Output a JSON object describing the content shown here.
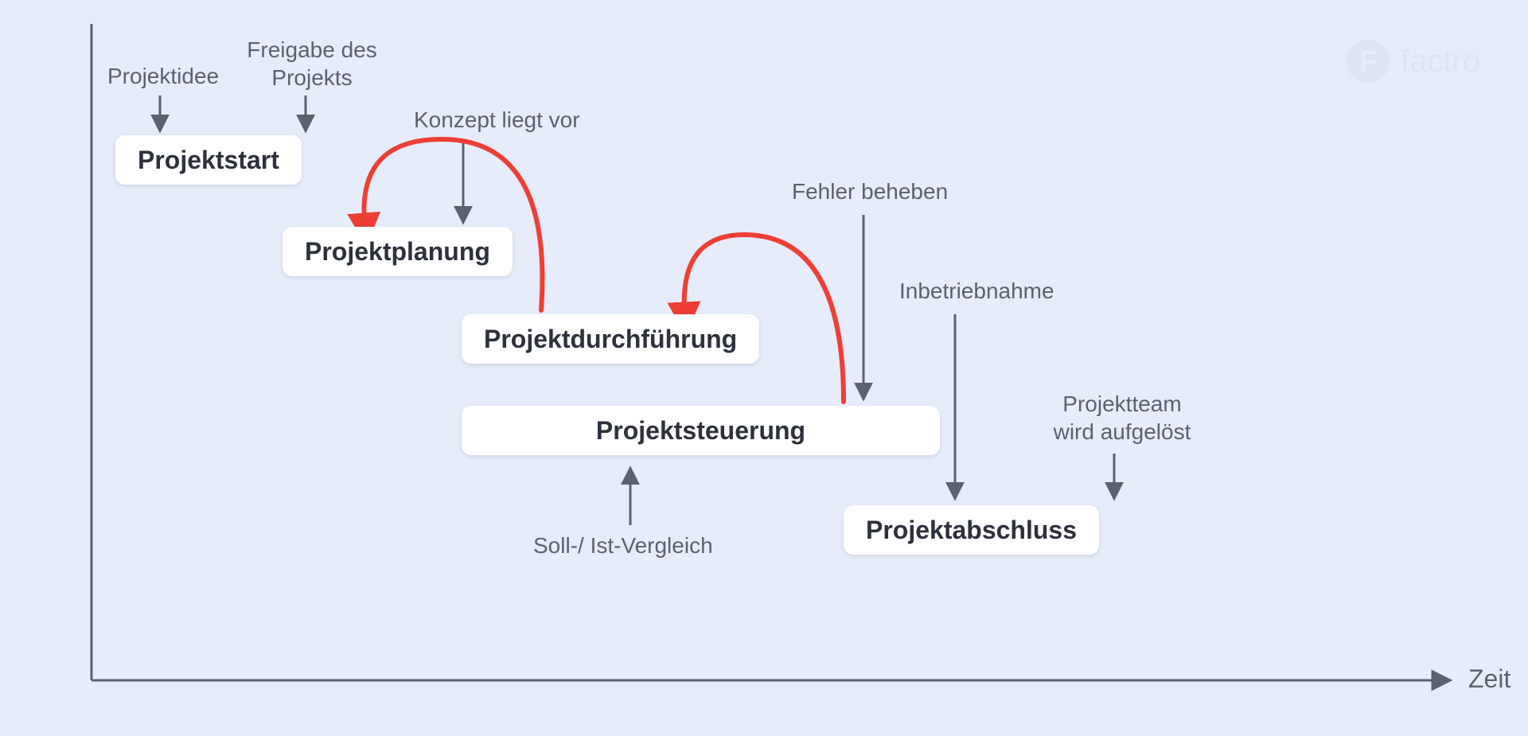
{
  "logo": {
    "letter": "F",
    "name": "factro"
  },
  "axis": {
    "x_label": "Zeit"
  },
  "phases": {
    "start": {
      "label": "Projektstart"
    },
    "planung": {
      "label": "Projektplanung"
    },
    "durchf": {
      "label": "Projektdurchführung"
    },
    "steuerung": {
      "label": "Projektsteuerung"
    },
    "abschluss": {
      "label": "Projektabschluss"
    }
  },
  "annotations": {
    "idee": "Projektidee",
    "freigabe_l1": "Freigabe des",
    "freigabe_l2": "Projekts",
    "konzept": "Konzept liegt vor",
    "fehler": "Fehler beheben",
    "inbetrieb": "Inbetriebnahme",
    "team_l1": "Projektteam",
    "team_l2": "wird aufgelöst",
    "sollist": "Soll-/ Ist-Vergleich"
  }
}
